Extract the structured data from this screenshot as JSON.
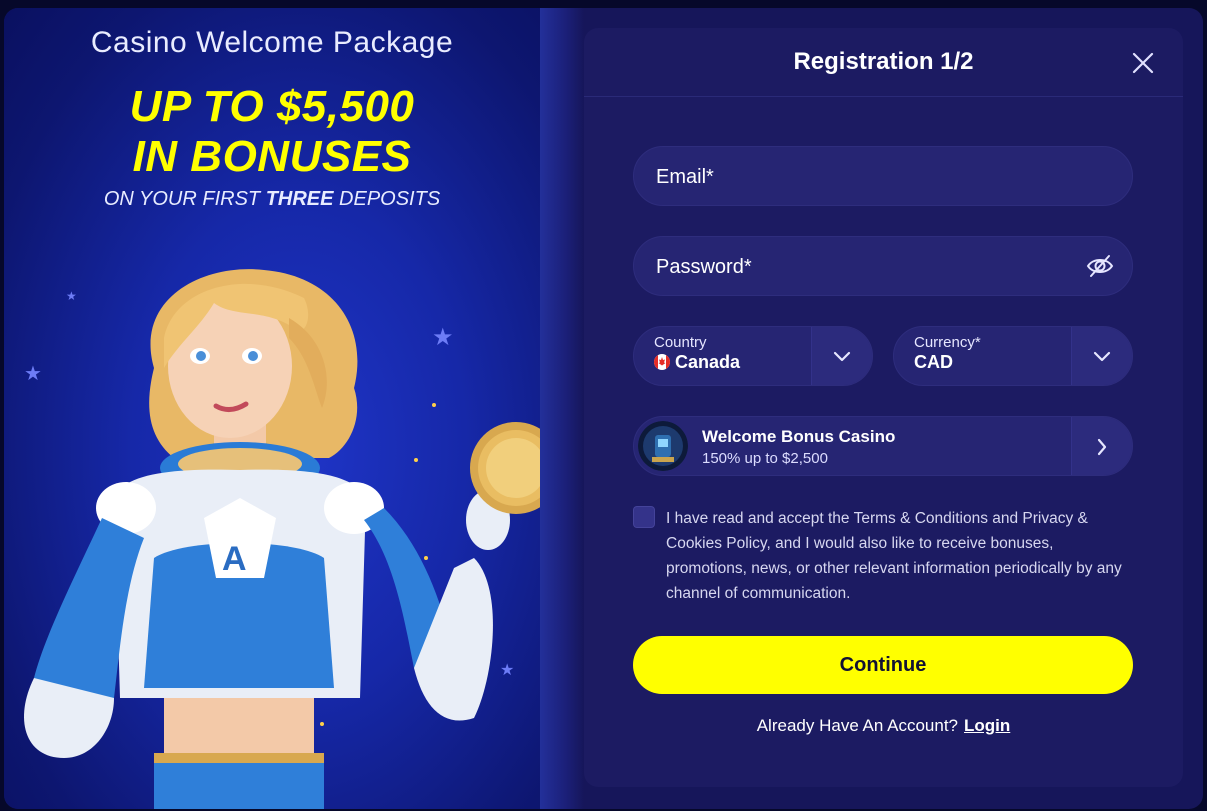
{
  "promo": {
    "subtitle": "Casino Welcome Package",
    "headline_line1": "UP TO $5,500",
    "headline_line2": "IN BONUSES",
    "tagline_prefix": "ON YOUR FIRST ",
    "tagline_emphasis": "THREE",
    "tagline_suffix": " DEPOSITS"
  },
  "form": {
    "title": "Registration 1/2",
    "close_icon": "close-icon",
    "email_placeholder": "Email*",
    "password_placeholder": "Password*",
    "password_toggle_icon": "eye-slash-icon",
    "country": {
      "label": "Country",
      "value": "Canada",
      "flag_icon": "canada-flag-icon"
    },
    "currency": {
      "label": "Currency*",
      "value": "CAD"
    },
    "bonus": {
      "title": "Welcome Bonus Casino",
      "description": "150% up to $2,500"
    },
    "terms_text": "I have read and accept the Terms & Conditions and Privacy & Cookies Policy, and I would also like to receive bonuses, promotions, news, or other relevant information periodically by any channel of communication.",
    "continue_label": "Continue",
    "login_prompt": "Already Have An Account?",
    "login_link": "Login"
  },
  "colors": {
    "accent": "#ffff00",
    "panel_bg": "#1c1b62",
    "field_bg": "#262573",
    "promo_bg": "#1628a8"
  }
}
